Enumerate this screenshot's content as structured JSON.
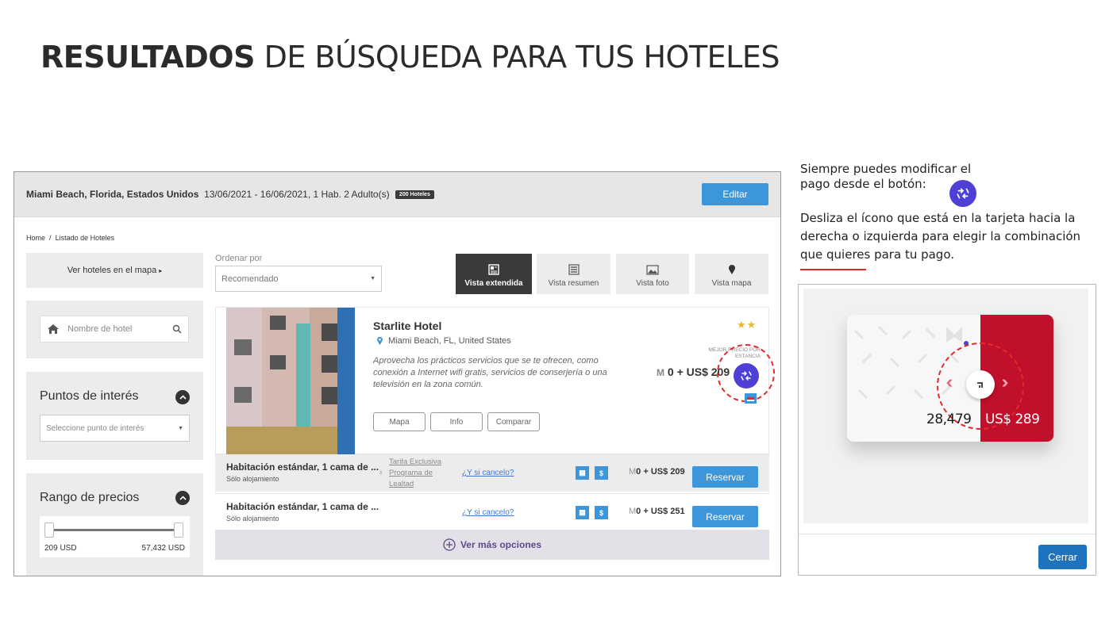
{
  "title": {
    "bold": "RESULTADOS",
    "light": "DE BÚSQUEDA PARA TUS HOTELES"
  },
  "mock": {
    "header": {
      "destination": "Miami Beach, Florida, Estados Unidos",
      "details": "13/06/2021 - 16/06/2021,  1 Hab. 2 Adulto(s)",
      "count_badge": "200 Hoteles",
      "edit_label": "Editar"
    },
    "breadcrumb": {
      "home": "Home",
      "separator": "/",
      "current": "Listado de Hoteles"
    },
    "sidebar": {
      "map_link": "Ver hoteles en el mapa",
      "map_arrow": "▸",
      "hotel_search_placeholder": "Nombre de hotel",
      "poi_title": "Puntos de interés",
      "poi_placeholder": "Seleccione punto de interés",
      "price_title": "Rango de precios",
      "price_min": "209 USD",
      "price_max": "57,432 USD"
    },
    "order": {
      "label": "Ordenar por",
      "value": "Recomendado"
    },
    "view_tabs": [
      {
        "label": "Vista extendida",
        "icon": "newspaper-icon",
        "active": true
      },
      {
        "label": "Vista resumen",
        "icon": "list-icon",
        "active": false
      },
      {
        "label": "Vista foto",
        "icon": "image-icon",
        "active": false
      },
      {
        "label": "Vista mapa",
        "icon": "map-pin-icon",
        "active": false
      }
    ],
    "hotel": {
      "name": "Starlite Hotel",
      "location": "Miami Beach, FL, United States",
      "description": "Aprovecha los prácticos servicios que se te ofrecen, como conexión a Internet wifi gratis, servicios de conserjería o una televisión en la zona común.",
      "stars": "★★",
      "best_price_label": "MEJOR PRECIO POR ESTANCIA",
      "price": "0 + US$ 209",
      "buttons": {
        "map": "Mapa",
        "info": "Info",
        "compare": "Comparar"
      }
    },
    "rates": [
      {
        "name": "Habitación estándar, 1 cama de ...",
        "sub": "Sólo alojamiento",
        "tarifa": "Tarifa Exclusiva Programa de Lealtad",
        "cancel": "¿Y si cancelo?",
        "price": "0 + US$ 209",
        "button": "Reservar"
      },
      {
        "name": "Habitación estándar, 1 cama de ...",
        "sub": "Sólo alojamiento",
        "tarifa": "",
        "cancel": "¿Y si cancelo?",
        "price": "0 + US$ 251",
        "button": "Reservar"
      }
    ],
    "more_options": "Ver más opciones"
  },
  "right": {
    "text1_line1": "Siempre puedes modificar el",
    "text1_line2": "pago desde el botón:",
    "text2": "Desliza el ícono que está en la tarjeta hacia la derecha o izquierda para elegir la combinación que quieres para tu pago.",
    "demo_points": "28,479",
    "demo_usd": "US$ 289",
    "close_label": "Cerrar"
  },
  "colors": {
    "accent_blue": "#3d96d9",
    "toggle_purple": "#4e3fd6",
    "highlight_red": "#e12b2b",
    "card_red": "#c0102c"
  }
}
